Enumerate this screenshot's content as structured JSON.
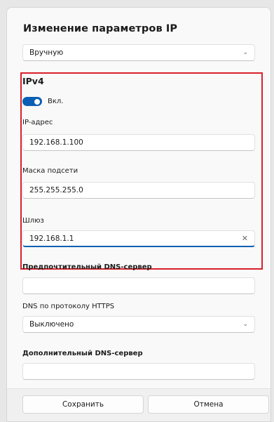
{
  "dialog": {
    "title": "Изменение параметров IP",
    "mode_select": {
      "value": "Вручную"
    },
    "ipv4": {
      "section_title": "IPv4",
      "toggle_label": "Вкл.",
      "toggle_on": true,
      "ip_address": {
        "label": "IP-адрес",
        "value": "192.168.1.100"
      },
      "subnet_mask": {
        "label": "Маска подсети",
        "value": "255.255.255.0"
      },
      "gateway": {
        "label": "Шлюз",
        "value": "192.168.1.1"
      }
    },
    "preferred_dns": {
      "label": "Предпочтительный DNS-сервер",
      "value": ""
    },
    "dns_https": {
      "label": "DNS по протоколу HTTPS",
      "value": "Выключено"
    },
    "alternate_dns": {
      "label": "Дополнительный DNS-сервер",
      "value": ""
    },
    "buttons": {
      "save": "Сохранить",
      "cancel": "Отмена"
    },
    "colors": {
      "accent": "#0a5fb4",
      "highlight": "#d9202a"
    },
    "icons": {
      "select": "chevron-down-icon",
      "clear": "close-icon"
    }
  }
}
